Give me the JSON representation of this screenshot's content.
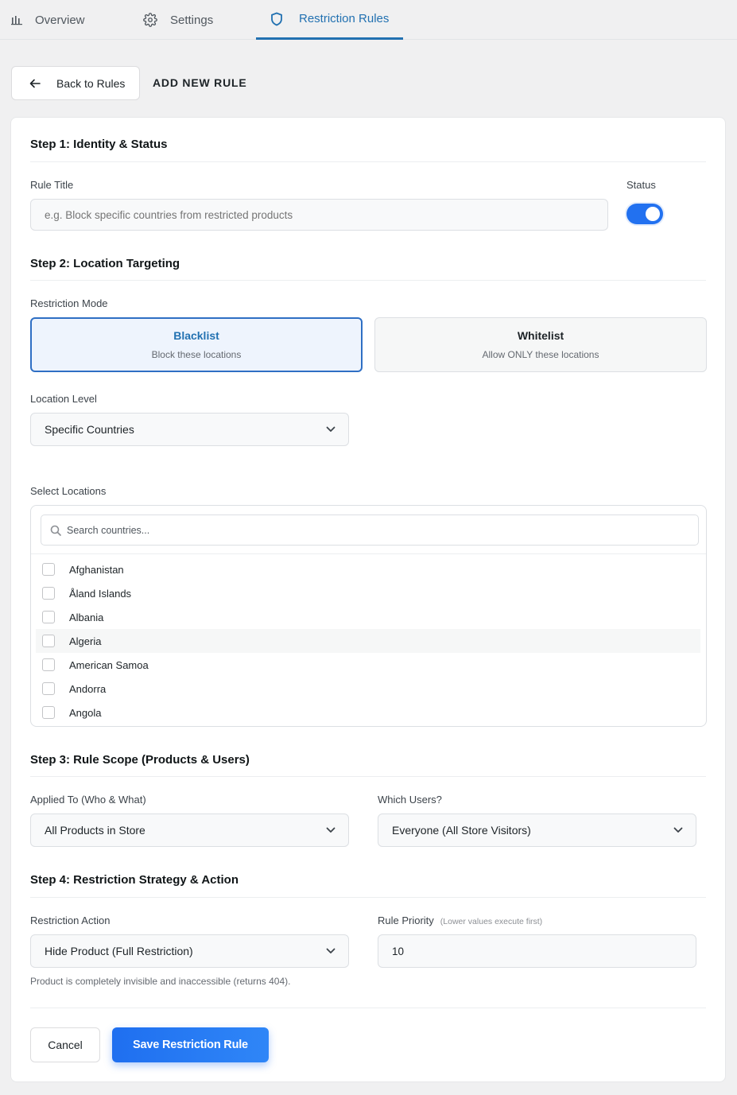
{
  "tabs": [
    {
      "label": "Overview",
      "icon": "bar-chart-icon"
    },
    {
      "label": "Settings",
      "icon": "gear-icon"
    },
    {
      "label": "Restriction Rules",
      "icon": "shield-icon",
      "active": true
    }
  ],
  "header": {
    "back_label": "Back to Rules",
    "title": "ADD NEW RULE"
  },
  "step1": {
    "title": "Step 1: Identity & Status",
    "rule_title_label": "Rule Title",
    "rule_title_value": "",
    "rule_title_placeholder": "e.g. Block specific countries from restricted products",
    "status_label": "Status",
    "status_on": true
  },
  "step2": {
    "title": "Step 2: Location Targeting",
    "mode_label": "Restriction Mode",
    "modes": [
      {
        "title": "Blacklist",
        "subtitle": "Block these locations",
        "selected": true
      },
      {
        "title": "Whitelist",
        "subtitle": "Allow ONLY these locations",
        "selected": false
      }
    ],
    "level_label": "Location Level",
    "level_value": "Specific Countries",
    "select_label": "Select Locations",
    "search_placeholder": "Search countries...",
    "locations": [
      "Afghanistan",
      "Åland Islands",
      "Albania",
      "Algeria",
      "American Samoa",
      "Andorra",
      "Angola"
    ]
  },
  "step3": {
    "title": "Step 3: Rule Scope (Products & Users)",
    "applied_label": "Applied To (Who & What)",
    "applied_value": "All Products in Store",
    "users_label": "Which Users?",
    "users_value": "Everyone (All Store Visitors)"
  },
  "step4": {
    "title": "Step 4: Restriction Strategy & Action",
    "action_label": "Restriction Action",
    "action_value": "Hide Product (Full Restriction)",
    "action_hint": "Product is completely invisible and inaccessible (returns 404).",
    "priority_label": "Rule Priority",
    "priority_hint": "(Lower values execute first)",
    "priority_value": "10"
  },
  "footer": {
    "cancel_label": "Cancel",
    "save_label": "Save Restriction Rule"
  },
  "colors": {
    "accent": "#2271b1",
    "primary_button": "#1f6ff0",
    "toggle_on": "#2271f0"
  }
}
